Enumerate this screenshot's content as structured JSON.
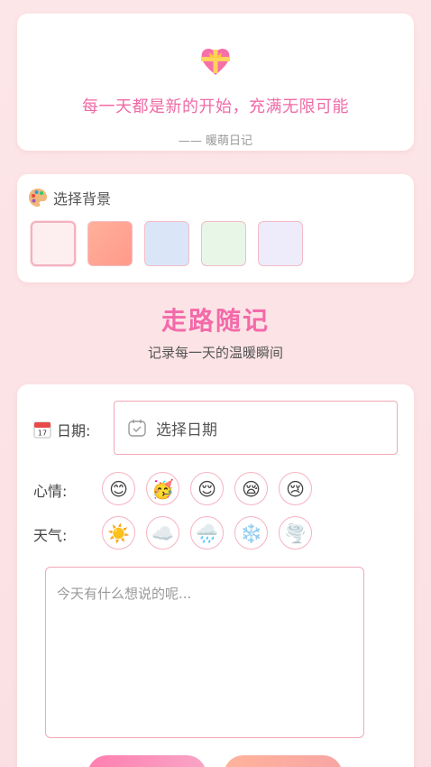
{
  "quote": {
    "icon": "heart-ribbon-icon",
    "text": "每一天都是新的开始，充满无限可能",
    "author": "—— 暖萌日记"
  },
  "background": {
    "title": "选择背景",
    "icon": "palette-icon",
    "swatches": [
      {
        "name": "pink-light",
        "color": "#fdeef0"
      },
      {
        "name": "peach",
        "color": "#ffa58c"
      },
      {
        "name": "blue",
        "color": "#dbe5f8"
      },
      {
        "name": "green",
        "color": "#e8f6e8"
      },
      {
        "name": "lavender",
        "color": "#eeebfb"
      }
    ],
    "selected_index": 0
  },
  "app": {
    "title": "走路随记",
    "subtitle": "记录每一天的温暖瞬间"
  },
  "form": {
    "date_label": "日期:",
    "date_placeholder": "选择日期",
    "mood_label": "心情:",
    "moods": [
      "😊",
      "🥳",
      "😌",
      "😪",
      "😢"
    ],
    "weather_label": "天气:",
    "weathers": [
      "☀️",
      "☁️",
      "🌧️",
      "❄️",
      "🌪️"
    ],
    "note_placeholder": "今天有什么想说的呢..."
  },
  "colors": {
    "accent": "#f46aa9",
    "border": "#f3a7b8",
    "page_bg": "#fde6e8"
  }
}
